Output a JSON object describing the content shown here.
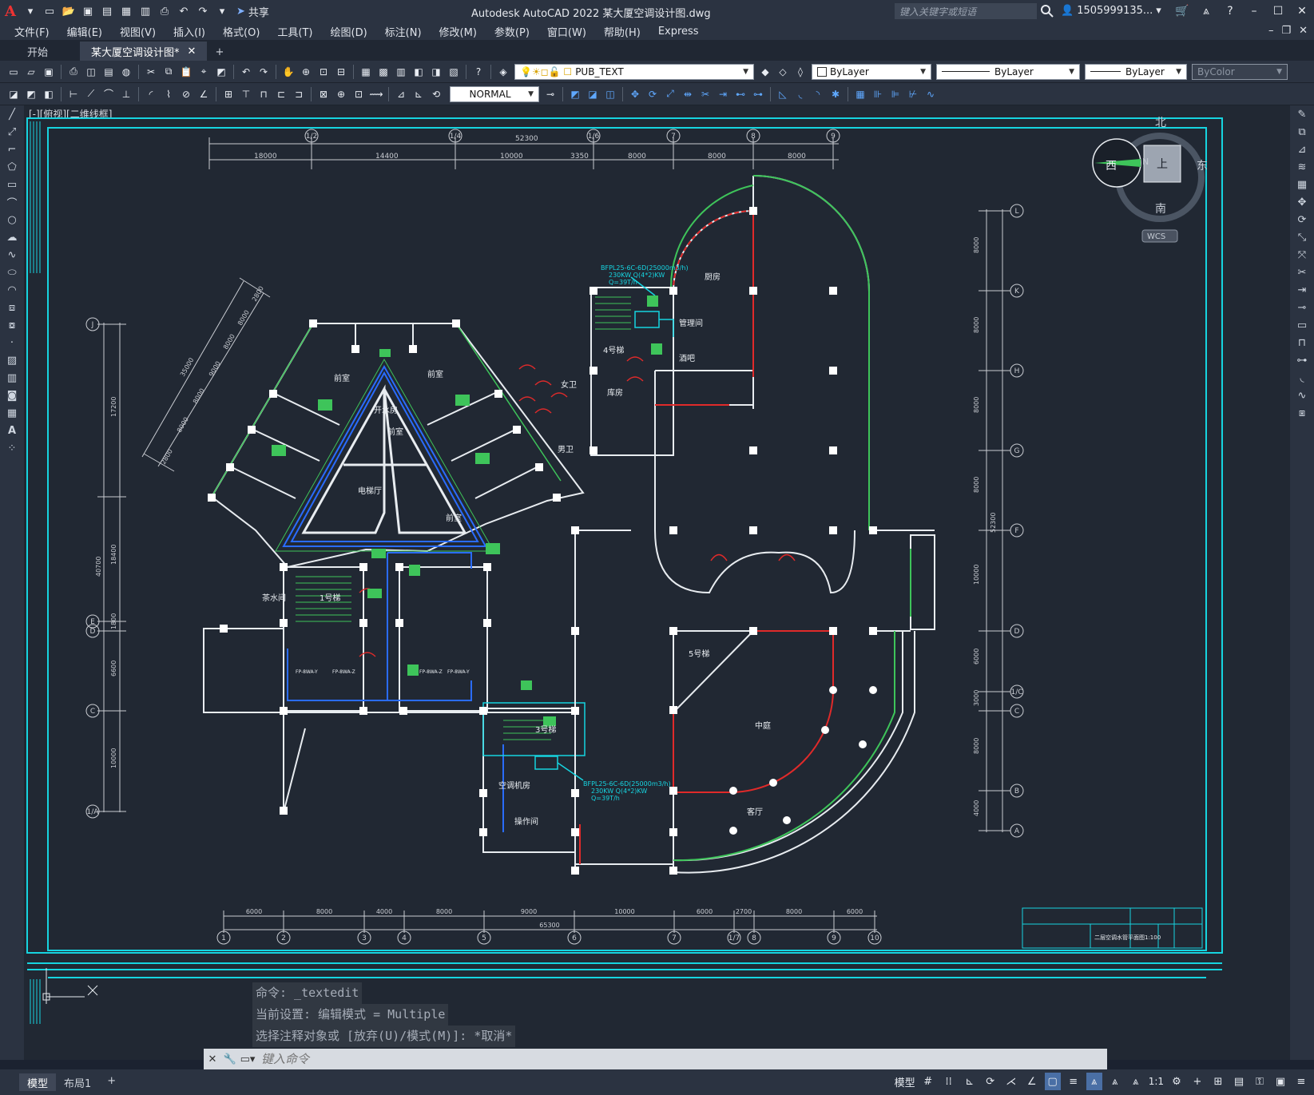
{
  "app": {
    "logo": "A",
    "title": "Autodesk AutoCAD 2022    某大厦空调设计图.dwg",
    "share_label": "共享",
    "search_placeholder": "键入关键字或短语",
    "user_name": "1505999135..."
  },
  "menu": [
    "文件(F)",
    "编辑(E)",
    "视图(V)",
    "插入(I)",
    "格式(O)",
    "工具(T)",
    "绘图(D)",
    "标注(N)",
    "修改(M)",
    "参数(P)",
    "窗口(W)",
    "帮助(H)",
    "Express"
  ],
  "tabs": [
    {
      "label": "开始"
    },
    {
      "label": "某大厦空调设计图*"
    }
  ],
  "toolbar": {
    "layer_name": "PUB_TEXT",
    "color": "ByLayer",
    "linetype": "ByLayer",
    "lineweight": "ByLayer",
    "plotstyle": "ByColor",
    "text_style": "NORMAL"
  },
  "viewport": {
    "label": "[-][俯视][二维线框]",
    "viewcube": {
      "north": "北",
      "south": "南",
      "east": "东",
      "west": "西",
      "face": "上",
      "compass_n": "N",
      "ucs": "WCS"
    }
  },
  "drawing": {
    "grid_top": [
      "1/2",
      "1/4",
      "1/6",
      "7",
      "8",
      "9"
    ],
    "grid_bottom": [
      "1",
      "2",
      "3",
      "4",
      "5",
      "6",
      "7",
      "1/7",
      "8",
      "9",
      "10"
    ],
    "grid_right": [
      "L",
      "K",
      "H",
      "G",
      "F",
      "D",
      "1/C",
      "C",
      "B",
      "A"
    ],
    "grid_left": [
      "J",
      "E",
      "D",
      "C",
      "1/A"
    ],
    "dim_top_total": "52300",
    "dim_top": [
      "18000",
      "14400",
      "10000",
      "3350",
      "8000",
      "8000",
      "8000"
    ],
    "dim_bottom_total": "65300",
    "dim_bottom": [
      "6000",
      "8000",
      "4000",
      "8000",
      "9000",
      "10000",
      "6000",
      "2700",
      "8000",
      "6000"
    ],
    "dim_right": [
      "8000",
      "8000",
      "8000",
      "8000",
      "10000",
      "6000",
      "3000",
      "8000",
      "4000"
    ],
    "dim_right_total": "52300",
    "dim_left": [
      "17200",
      "18400",
      "1800",
      "6600",
      "10000"
    ],
    "dim_left_total": "40700",
    "dim_diag": [
      "2800",
      "8000",
      "8000",
      "9000",
      "8000",
      "8000",
      "2800"
    ],
    "dim_diag_total": "35000",
    "rooms": [
      "开水房",
      "前室",
      "电梯厅",
      "前室",
      "女卫",
      "男卫",
      "库房",
      "厨房",
      "管理间",
      "酒吧",
      "4号梯",
      "1号梯",
      "5号梯",
      "3号梯",
      "茶水间",
      "中庭",
      "客厅",
      "空调机房",
      "操作间",
      "前室",
      "前室"
    ],
    "ahu_note_1": [
      "BFPL25-6C-6D(25000m3/h)",
      "230KW  Q(4*2)KW",
      "Q=39T/h"
    ],
    "ahu_note_2": [
      "BFPL25-6C-6D(25000m3/h)",
      "230KW  Q(4*2)KW",
      "Q=39T/h"
    ],
    "fcu_labels": [
      "FP-8WA-Y",
      "FP-8WA-Z",
      "FP-8WA-Z",
      "FP-8WA-Y"
    ],
    "titleblock_title": "二层空调水管平面图1:100"
  },
  "command": {
    "history": [
      "命令: _textedit",
      "当前设置: 编辑模式 = Multiple",
      "选择注释对象或 [放弃(U)/模式(M)]: *取消*"
    ],
    "placeholder": "键入命令"
  },
  "status": {
    "tabs": [
      "模型",
      "布局1"
    ],
    "model_label": "模型",
    "scale": "1:1"
  },
  "colors": {
    "canvas": "#212833",
    "wall": "#e8ecf0",
    "cyan": "#16d4e0",
    "green": "#3ec45a",
    "red": "#e02a2a",
    "blue": "#2a6cff",
    "dim": "#c9ccd2"
  }
}
